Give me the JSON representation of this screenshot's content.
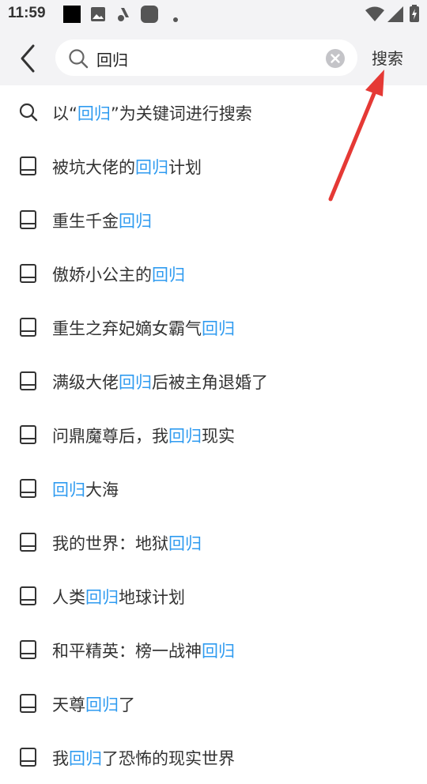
{
  "status_bar": {
    "time": "11:59"
  },
  "search": {
    "back_label": "",
    "value": "回归",
    "search_button": "搜索"
  },
  "suggestions": [
    {
      "type": "keyword",
      "before": "以“",
      "highlight": "回归",
      "after": "”为关键词进行搜索"
    },
    {
      "type": "book",
      "before": "被坑大佬的",
      "highlight": "回归",
      "after": "计划"
    },
    {
      "type": "book",
      "before": "重生千金",
      "highlight": "回归",
      "after": ""
    },
    {
      "type": "book",
      "before": "傲娇小公主的",
      "highlight": "回归",
      "after": ""
    },
    {
      "type": "book",
      "before": "重生之弃妃嫡女霸气",
      "highlight": "回归",
      "after": ""
    },
    {
      "type": "book",
      "before": "满级大佬",
      "highlight": "回归",
      "after": "后被主角退婚了"
    },
    {
      "type": "book",
      "before": "问鼎魔尊后，我",
      "highlight": "回归",
      "after": "现实"
    },
    {
      "type": "book",
      "before": "",
      "highlight": "回归",
      "after": "大海"
    },
    {
      "type": "book",
      "before": "我的世界：地狱",
      "highlight": "回归",
      "after": ""
    },
    {
      "type": "book",
      "before": "人类",
      "highlight": "回归",
      "after": "地球计划"
    },
    {
      "type": "book",
      "before": "和平精英：榜一战神",
      "highlight": "回归",
      "after": ""
    },
    {
      "type": "book",
      "before": "天尊",
      "highlight": "回归",
      "after": "了"
    },
    {
      "type": "book",
      "before": "我",
      "highlight": "回归",
      "after": "了恐怖的现实世界"
    }
  ],
  "colors": {
    "highlight": "#2f9bf0",
    "header_bg": "#f3f3f5",
    "annotation_arrow": "#e53935"
  }
}
